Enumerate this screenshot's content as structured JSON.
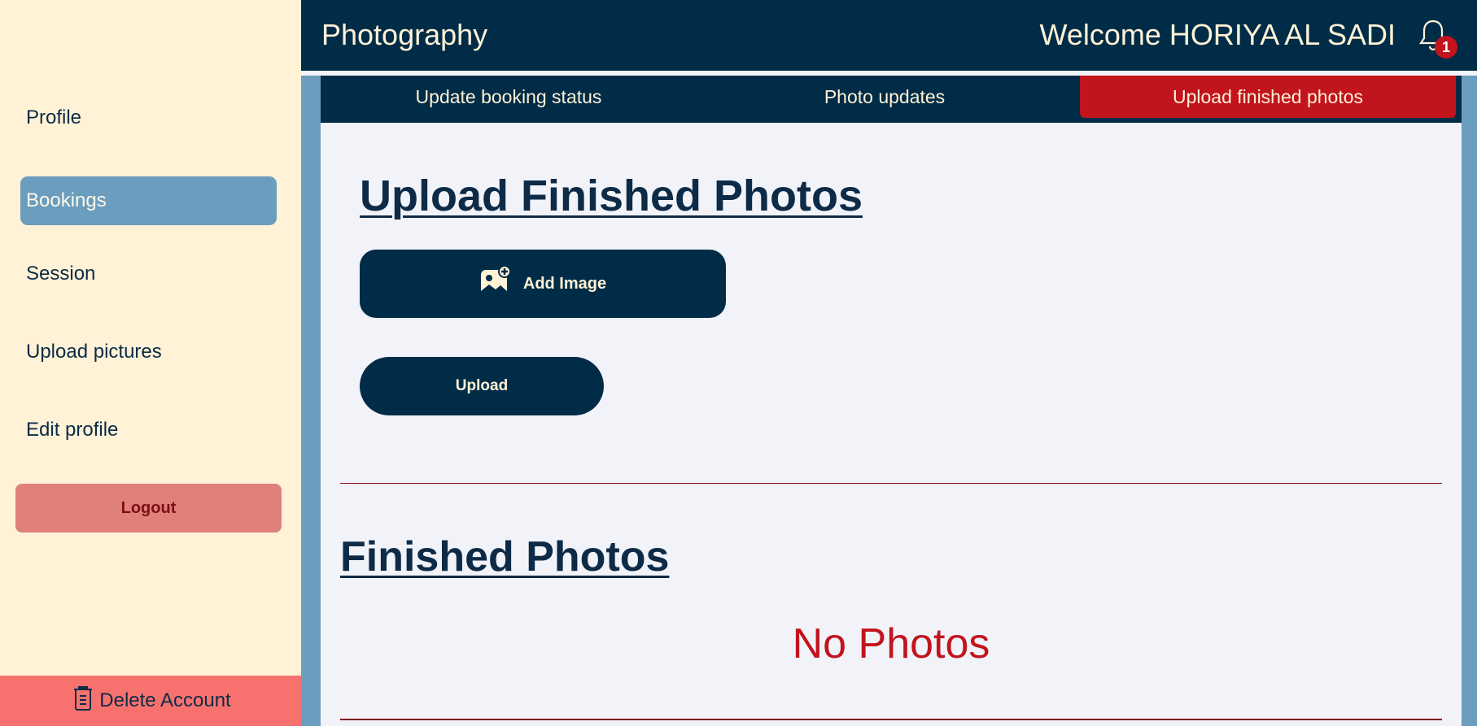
{
  "sidebar": {
    "items": [
      {
        "label": "Profile"
      },
      {
        "label": "Bookings"
      },
      {
        "label": "Session"
      },
      {
        "label": "Upload pictures"
      },
      {
        "label": "Edit profile"
      }
    ],
    "logout_label": "Logout",
    "delete_label": "Delete Account",
    "delete_icon": "trash-icon"
  },
  "header": {
    "title": "Photography",
    "welcome": "Welcome HORIYA AL SADI",
    "bell_icon": "bell-icon",
    "notification_count": "1"
  },
  "tabs": [
    {
      "label": "Update booking status"
    },
    {
      "label": "Photo updates"
    },
    {
      "label": "Upload finished photos"
    }
  ],
  "upload_section": {
    "heading": "Upload Finished Photos",
    "add_image_label": "Add Image",
    "add_image_icon": "add-image-icon",
    "upload_label": "Upload"
  },
  "finished_section": {
    "heading": "Finished Photos",
    "empty_text": "No Photos"
  },
  "colors": {
    "navy": "#002c47",
    "cream": "#fff2d6",
    "accent_red": "#c2141d",
    "active_nav": "#6a9dbe",
    "logout_bg": "#df807a",
    "delete_bg": "#f7726f"
  }
}
